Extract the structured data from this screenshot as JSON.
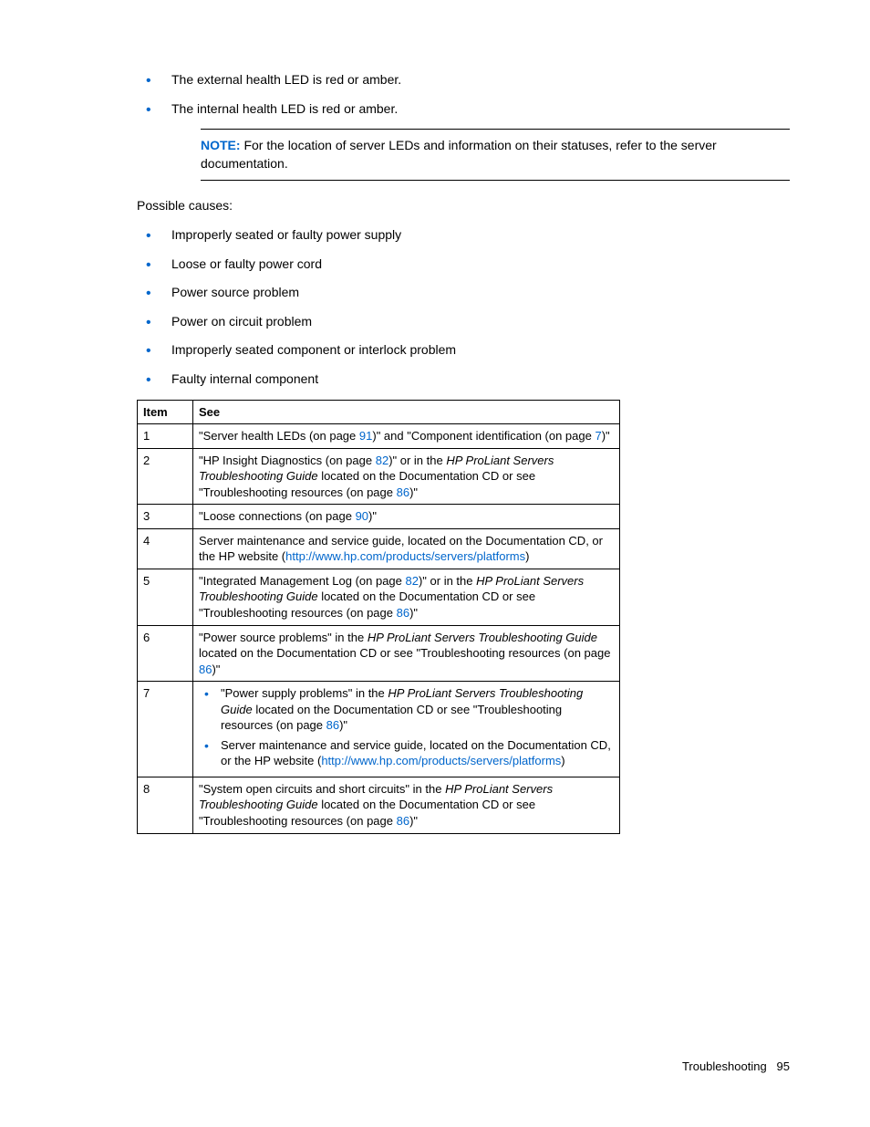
{
  "top_bullets": [
    "The external health LED is red or amber.",
    "The internal health LED is red or amber."
  ],
  "note": {
    "label": "NOTE:",
    "text": "For the location of server LEDs and information on their statuses, refer to the server documentation."
  },
  "causes_label": "Possible causes:",
  "causes": [
    "Improperly seated or faulty power supply",
    "Loose or faulty power cord",
    "Power source problem",
    "Power on circuit problem",
    "Improperly seated component or interlock problem",
    "Faulty internal component"
  ],
  "table": {
    "headers": [
      "Item",
      "See"
    ],
    "rows": {
      "r1": {
        "item": "1",
        "t1": "\"Server health LEDs (on page ",
        "l1": "91",
        "t2": ")\" and \"Component identification (on page ",
        "l2": "7",
        "t3": ")\""
      },
      "r2": {
        "item": "2",
        "t1": "\"HP Insight Diagnostics (on page ",
        "l1": "82",
        "t2": ")\" or in the ",
        "i1": "HP ProLiant Servers Troubleshooting Guide",
        "t3": " located on the Documentation CD or see \"Troubleshooting resources (on page ",
        "l2": "86",
        "t4": ")\""
      },
      "r3": {
        "item": "3",
        "t1": "\"Loose connections (on page ",
        "l1": "90",
        "t2": ")\""
      },
      "r4": {
        "item": "4",
        "t1": "Server maintenance and service guide, located on the Documentation CD, or the HP website (",
        "l1": "http://www.hp.com/products/servers/platforms",
        "t2": ")"
      },
      "r5": {
        "item": "5",
        "t1": "\"Integrated Management Log (on page ",
        "l1": "82",
        "t2": ")\" or in the ",
        "i1": "HP ProLiant Servers Troubleshooting Guide",
        "t3": " located on the Documentation CD or see \"Troubleshooting resources (on page ",
        "l2": "86",
        "t4": ")\""
      },
      "r6": {
        "item": "6",
        "t1": "\"Power source problems\" in the ",
        "i1": "HP ProLiant Servers Troubleshooting Guide",
        "t2": " located on the Documentation CD or see \"Troubleshooting resources (on page ",
        "l1": "86",
        "t3": ")\""
      },
      "r7": {
        "item": "7",
        "a_t1": "\"Power supply problems\" in the ",
        "a_i1": "HP ProLiant Servers Troubleshooting Guide",
        "a_t2": " located on the Documentation CD or see \"Troubleshooting resources (on page ",
        "a_l1": "86",
        "a_t3": ")\"",
        "b_t1": "Server maintenance and service guide, located on the Documentation CD, or the HP website (",
        "b_l1": "http://www.hp.com/products/servers/platforms",
        "b_t2": ")"
      },
      "r8": {
        "item": "8",
        "t1": "\"System open circuits and short circuits\" in the ",
        "i1": "HP ProLiant Servers Troubleshooting Guide",
        "t2": " located on the Documentation CD or see \"Troubleshooting resources (on page ",
        "l1": "86",
        "t3": ")\""
      }
    }
  },
  "footer": {
    "section": "Troubleshooting",
    "page": "95"
  }
}
